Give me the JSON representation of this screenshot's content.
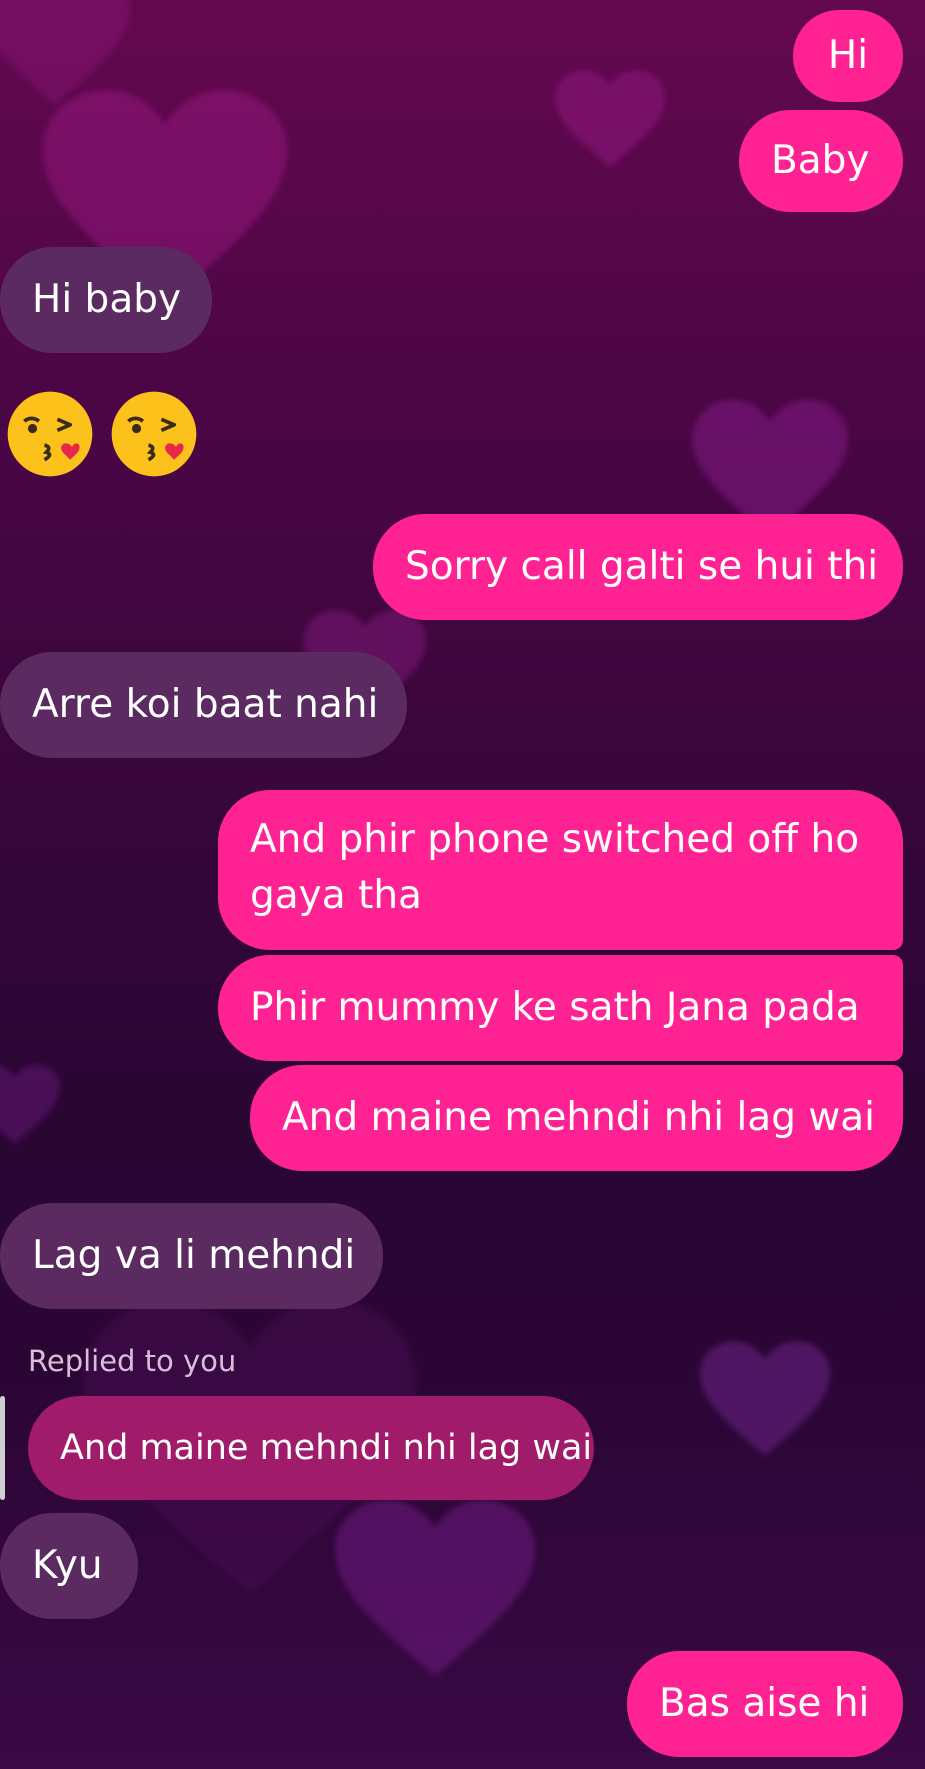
{
  "colors": {
    "sent_bubble": "#ff2292",
    "received_bubble": "#5a2a60",
    "reply_quote_bubble": "#a01c6a"
  },
  "background": {
    "theme": "purple-hearts"
  },
  "messages": {
    "m1": "Hi",
    "m2": "Baby",
    "m3": "Hi baby",
    "m4_emojis": [
      "kissing-face-heart-icon",
      "kissing-face-heart-icon"
    ],
    "m5": "Sorry call galti se hui thi",
    "m6": "Arre koi baat nahi",
    "m7": "And phir phone switched off ho gaya tha",
    "m8": "Phir mummy ke sath Jana pada",
    "m9": "And maine mehndi nhi lag wai",
    "m10": "Lag va li mehndi",
    "reply_label": "Replied to you",
    "reply_quote": "And maine mehndi nhi lag wai",
    "m11": "Kyu",
    "m12": "Bas aise hi"
  }
}
